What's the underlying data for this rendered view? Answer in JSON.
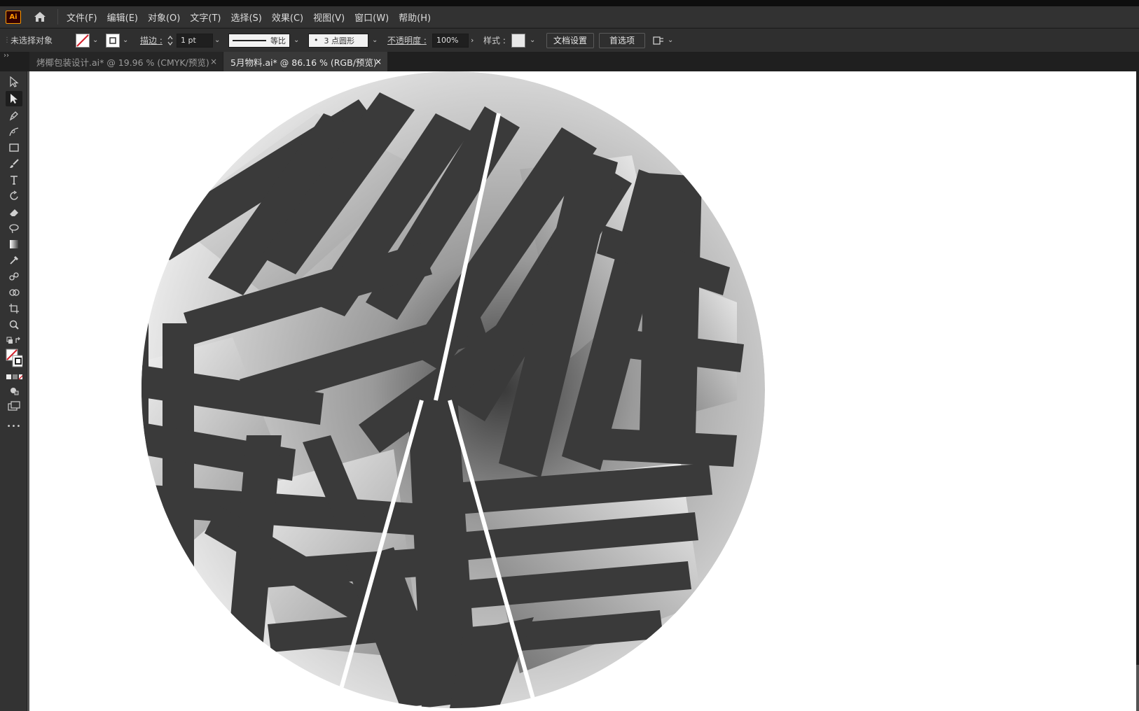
{
  "app": {
    "logo_text": "Ai",
    "icons": {
      "home": "home-icon"
    }
  },
  "menu": {
    "items": [
      "文件(F)",
      "编辑(E)",
      "对象(O)",
      "文字(T)",
      "选择(S)",
      "效果(C)",
      "视图(V)",
      "窗口(W)",
      "帮助(H)"
    ]
  },
  "control_bar": {
    "selection_status": "未选择对象",
    "stroke_label": "描边 :",
    "stroke_weight": "1 pt",
    "stroke_profile": "等比",
    "brush": "3 点圆形",
    "brush_dot": "•",
    "opacity_label": "不透明度 :",
    "opacity_value": "100%",
    "style_label": "样式 :",
    "doc_settings_button": "文档设置",
    "preferences_button": "首选项"
  },
  "tabs": [
    {
      "label": "烤椰包装设计.ai* @ 19.96 % (CMYK/预览)",
      "active": false
    },
    {
      "label": "5月物料.ai* @ 86.16 % (RGB/预览)",
      "active": true
    }
  ],
  "tab_close_glyph": "×",
  "toolbar": {
    "collapse_glyph": "››",
    "tools": [
      "selection-tool",
      "direct-selection-tool",
      "pen-tool",
      "curvature-tool",
      "rectangle-tool",
      "paintbrush-tool",
      "type-tool",
      "rotate-tool",
      "eraser-tool",
      "lasso-tool",
      "gradient-tool",
      "eyedropper-tool",
      "blend-tool",
      "shape-builder-tool",
      "artboard-tool",
      "zoom-tool"
    ],
    "more_glyph": "•••"
  },
  "colors": {
    "accent": "#ff9a00",
    "art_dark": "#3a3a3a",
    "artboard": "#ffffff",
    "stroke_none_red": "#d4202a"
  }
}
